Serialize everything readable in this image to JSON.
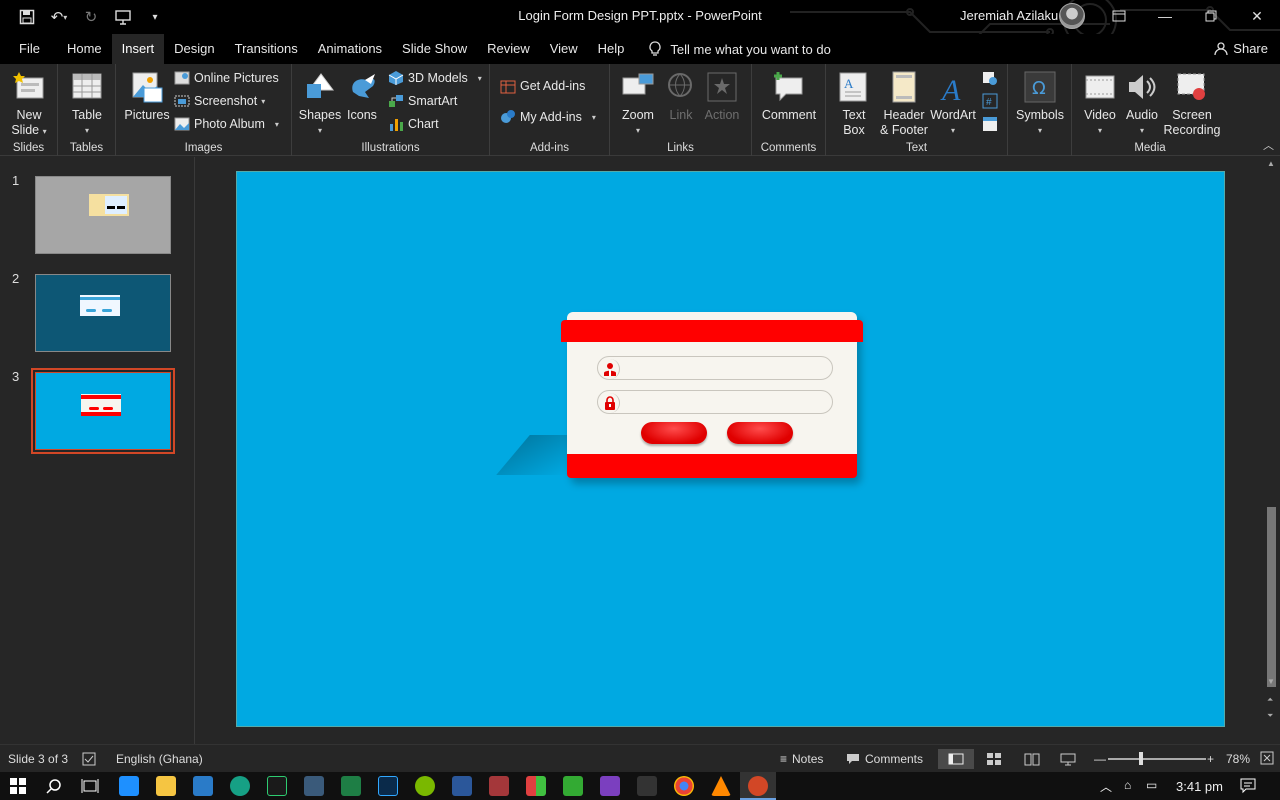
{
  "window": {
    "title": "Login Form Design PPT.pptx  -  PowerPoint",
    "user": "Jeremiah Azilaku"
  },
  "tabs": [
    "File",
    "Home",
    "Insert",
    "Design",
    "Transitions",
    "Animations",
    "Slide Show",
    "Review",
    "View",
    "Help"
  ],
  "active_tab": "Insert",
  "tell_me": "Tell me what you want to do",
  "share": "Share",
  "ribbon": {
    "slides": {
      "label": "Slides",
      "new_slide": "New",
      "new_slide2": "Slide"
    },
    "tables": {
      "label": "Tables",
      "table": "Table"
    },
    "images": {
      "label": "Images",
      "pictures": "Pictures",
      "online_pictures": "Online Pictures",
      "screenshot": "Screenshot",
      "photo_album": "Photo Album"
    },
    "illustrations": {
      "label": "Illustrations",
      "shapes": "Shapes",
      "icons": "Icons",
      "models": "3D Models",
      "smartart": "SmartArt",
      "chart": "Chart"
    },
    "addins": {
      "label": "Add-ins",
      "get": "Get Add-ins",
      "my": "My Add-ins"
    },
    "links": {
      "label": "Links",
      "zoom": "Zoom",
      "link": "Link",
      "action": "Action"
    },
    "comments": {
      "label": "Comments",
      "comment": "Comment"
    },
    "text": {
      "label": "Text",
      "textbox1": "Text",
      "textbox2": "Box",
      "header1": "Header",
      "header2": "& Footer",
      "wordart": "WordArt"
    },
    "symbols": {
      "label": "Symbols",
      "symbols": "Symbols"
    },
    "media": {
      "label": "Media",
      "video": "Video",
      "audio": "Audio",
      "screen1": "Screen",
      "screen2": "Recording"
    }
  },
  "slides": [
    {
      "num": "1",
      "bg": "#a6a6a6"
    },
    {
      "num": "2",
      "bg": "#0d5775"
    },
    {
      "num": "3",
      "bg": "#00a9e2"
    }
  ],
  "selected_slide": 3,
  "status": {
    "slide_info": "Slide 3 of 3",
    "language": "English (Ghana)",
    "notes": "Notes",
    "comments": "Comments",
    "zoom": "78%"
  },
  "taskbar": {
    "time": "3:41 pm"
  },
  "colors": {
    "accent": "#d24726",
    "slide_bg": "#00a9e2",
    "form_red": "#ff0000"
  }
}
